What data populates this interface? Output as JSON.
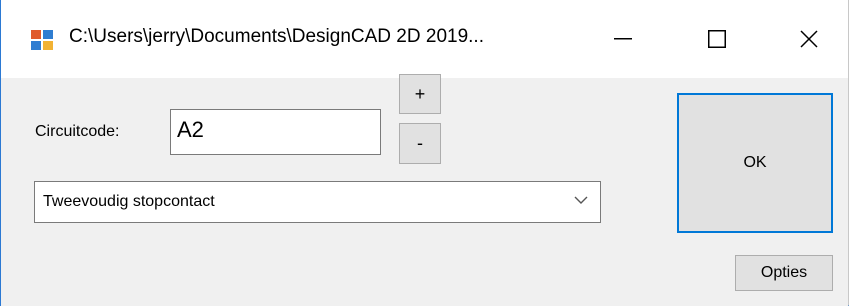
{
  "window": {
    "title": "C:\\Users\\jerry\\Documents\\DesignCAD 2D 2019...",
    "icons": {
      "app": "app-icon",
      "minimize": "minimize-icon",
      "maximize": "maximize-icon",
      "close": "close-icon"
    }
  },
  "form": {
    "circuit_label": "Circuitcode:",
    "circuit_value": "A2",
    "plus_label": "+",
    "minus_label": "-",
    "dropdown_value": "Tweevoudig stopcontact",
    "ok_label": "OK",
    "options_label": "Opties"
  },
  "colors": {
    "accent": "#0078d7",
    "button_bg": "#e1e1e1",
    "window_bg": "#f0f0f0"
  }
}
